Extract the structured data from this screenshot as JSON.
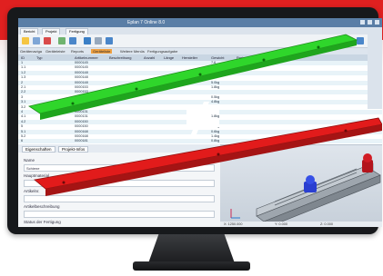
{
  "app": {
    "title": "Eplan 7 Online 8.0",
    "tabs": [
      "Bericht",
      "Projekt",
      "Fertigung"
    ],
    "subbar": [
      "Gerätenaviga",
      "Geräteleiste",
      "Reports",
      "Geräteliste",
      "Weitere Menüs",
      "Fertigungsaufgabe"
    ],
    "grid_headers": [
      "ID",
      "Typ",
      "Artikelnummer",
      "Beschreibung",
      "Anzahl",
      "Länge",
      "Hersteller",
      "Gewicht",
      "Preis"
    ],
    "rows": [
      {
        "id": "1",
        "num": "0000145",
        "val": "7.6"
      },
      {
        "id": "1.1",
        "num": "0000145",
        "val": "5.6kg"
      },
      {
        "id": "1.2",
        "num": "0000148",
        "val": "3.5kg"
      },
      {
        "id": "1.3",
        "num": "0000148",
        "val": ""
      },
      {
        "id": "2",
        "num": "0000148",
        "val": "5.0kg"
      },
      {
        "id": "2.1",
        "num": "0000153",
        "val": "1.8kg"
      },
      {
        "id": "2.2",
        "num": "0000153",
        "val": ""
      },
      {
        "id": "3",
        "num": "0000131",
        "val": "0.5kg"
      },
      {
        "id": "3.1",
        "num": "0000129",
        "val": "4.8kg"
      },
      {
        "id": "3.2",
        "num": "0000129",
        "val": ""
      },
      {
        "id": "4",
        "num": "0000131",
        "val": "1.5kg"
      },
      {
        "id": "4.1",
        "num": "0000131",
        "val": "1.8kg"
      },
      {
        "id": "4.2",
        "num": "0000150",
        "val": "1.5kg"
      },
      {
        "id": "5",
        "num": "0000150",
        "val": "1.7kg"
      },
      {
        "id": "5.1",
        "num": "0000168",
        "val": "0.6kg"
      },
      {
        "id": "5.2",
        "num": "0000168",
        "val": "1.4kg"
      },
      {
        "id": "6",
        "num": "0000181",
        "val": "0.8kg"
      }
    ],
    "lower_tabs": [
      "Eigenschaften",
      "Projekt-Infos"
    ],
    "fields": [
      "Name",
      "Hauptmaterial",
      "Artikelnr.",
      "Artikelbeschreibung",
      "Status der Fertigung"
    ],
    "field_values": [
      "Schiene",
      "",
      "",
      "",
      ""
    ],
    "status": [
      "X: 1250.000",
      "Y: 0.000",
      "Z: 0.000"
    ]
  },
  "overlay": {
    "symbol": "≠",
    "top_part_color": "#2fd62b",
    "bottom_part_color": "#e21b1b",
    "brand_band_color": "#e02020"
  }
}
